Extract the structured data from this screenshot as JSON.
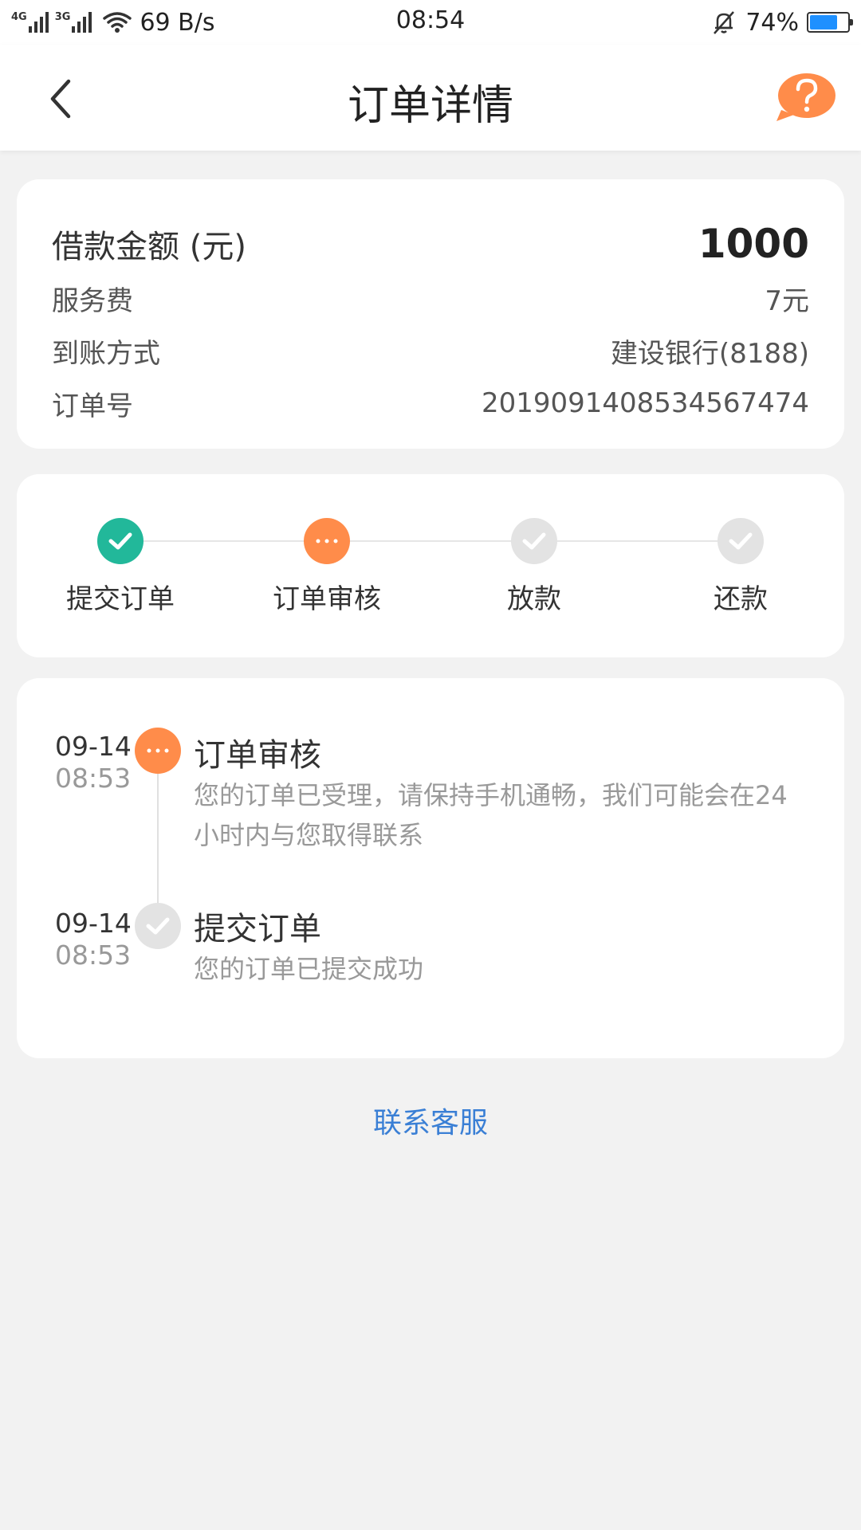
{
  "status_bar": {
    "net1": "4G",
    "net2": "3G",
    "speed": "69 B/s",
    "time": "08:54",
    "battery_text": "74%",
    "battery_level": 0.74,
    "battery_color": "#1e90ff"
  },
  "header": {
    "title": "订单详情",
    "back_icon": "chevron-left-icon",
    "help_icon": "question-bubble-icon"
  },
  "info": {
    "amount_label": "借款金额 (元)",
    "amount_value": "1000",
    "fee_label": "服务费",
    "fee_value": "7元",
    "method_label": "到账方式",
    "method_value": "建设银行(8188)",
    "order_label": "订单号",
    "order_value": "2019091408534567474"
  },
  "steps": [
    {
      "label": "提交订单",
      "state": "done"
    },
    {
      "label": "订单审核",
      "state": "current"
    },
    {
      "label": "放款",
      "state": "pending"
    },
    {
      "label": "还款",
      "state": "pending"
    }
  ],
  "timeline": [
    {
      "date": "09-14",
      "time": "08:53",
      "title": "订单审核",
      "desc": "您的订单已受理，请保持手机通畅，我们可能会在24小时内与您取得联系",
      "state": "current"
    },
    {
      "date": "09-14",
      "time": "08:53",
      "title": "提交订单",
      "desc": "您的订单已提交成功",
      "state": "done"
    }
  ],
  "contact": {
    "label": "联系客服"
  },
  "colors": {
    "done": "#22b89a",
    "current": "#ff8c4a",
    "pending": "#e3e3e3",
    "link": "#3a7fd5"
  }
}
